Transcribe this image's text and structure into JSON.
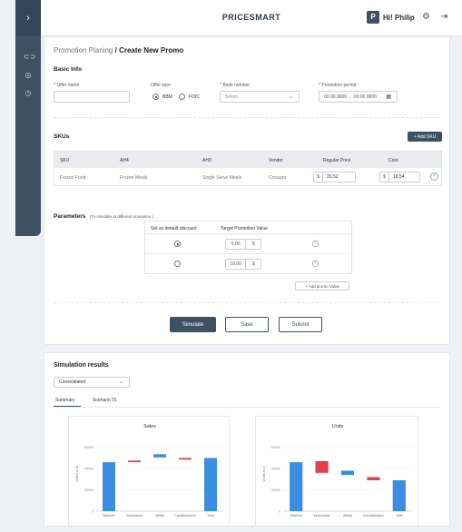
{
  "app": {
    "brand": "PRICESMART",
    "avatar_initial": "P",
    "greeting": "Hi! Philip"
  },
  "sidebar": {
    "toggle": "›",
    "icons": [
      "promo-icon",
      "tag-icon",
      "clock-icon"
    ]
  },
  "breadcrumb": {
    "parent": "Promotion Planing",
    "separator": "/",
    "current": "Create New Promo"
  },
  "basic_info": {
    "title": "Basic Info",
    "offer_name_label": "* Offer name",
    "offer_name_value": "",
    "offer_type_label": "Offer type",
    "offer_type_options": [
      "BBM",
      "FOIC"
    ],
    "offer_type_selected": "BBM",
    "book_number_label": "* Book number",
    "book_number_placeholder": "Select",
    "promo_period_label": "* Promotion period :",
    "promo_period_value": "00.00.0000  →  00.00.0000"
  },
  "skus": {
    "title": "SKUs",
    "add_label": "+  Add SKU",
    "headers": [
      "SKU",
      "AH4",
      "AH3",
      "Vendor",
      "Regular Price",
      "Cost"
    ],
    "rows": [
      {
        "sku": "Frozen Food",
        "ah4": "Frozen Meals",
        "ah3": "Single Serve Meals",
        "vendor": "Conagra",
        "regular_price_currency": "$",
        "regular_price": "20.52",
        "cost_currency": "$",
        "cost": "18.54"
      }
    ]
  },
  "parameters": {
    "title": "Parameters",
    "subtitle": "(To simulate at different scenarios )",
    "headers": [
      "Set as default discount",
      "Target Promotion Value"
    ],
    "rows": [
      {
        "default": true,
        "value": "5.00",
        "unit": "$"
      },
      {
        "default": false,
        "value": "10.00",
        "unit": "$"
      }
    ],
    "add_label": "+ Add promo Value"
  },
  "actions": {
    "simulate": "Simulate",
    "save": "Save",
    "submit": "Submit"
  },
  "results": {
    "title": "Simulation results",
    "view_selected": "Consolidated",
    "tabs": [
      "Summary",
      "Scenario 01"
    ],
    "active_tab": "Summary"
  },
  "colors": {
    "primary": "#3d5163",
    "blue": "#3a8de0",
    "red": "#e0414b"
  },
  "chart_data": [
    {
      "type": "bar",
      "subtype": "waterfall",
      "title": "Sales",
      "ylabel": "Sales in $",
      "categories": [
        "Baseline",
        "Incremental",
        "Affinity",
        "Cannibalization",
        "Total"
      ],
      "yticks": [
        "0",
        "20000",
        "40000",
        "60000"
      ],
      "ylim": [
        0,
        70000
      ],
      "bars": [
        {
          "start": 0,
          "end": 46000,
          "color": "blue"
        },
        {
          "start": 46000,
          "end": 47500,
          "color": "red"
        },
        {
          "start": 50500,
          "end": 53500,
          "color": "blue"
        },
        {
          "start": 48500,
          "end": 50000,
          "color": "red"
        },
        {
          "start": 0,
          "end": 50000,
          "color": "blue"
        }
      ]
    },
    {
      "type": "bar",
      "subtype": "waterfall",
      "title": "Units",
      "ylabel": "Units in #",
      "categories": [
        "Baseline",
        "Incremental",
        "Affinity",
        "Cannibalization",
        "Total"
      ],
      "yticks": [
        "0",
        "20000",
        "40000",
        "60000"
      ],
      "ylim": [
        0,
        70000
      ],
      "bars": [
        {
          "start": 0,
          "end": 46000,
          "color": "blue"
        },
        {
          "start": 36000,
          "end": 47000,
          "color": "red"
        },
        {
          "start": 34000,
          "end": 38000,
          "color": "blue"
        },
        {
          "start": 29000,
          "end": 32000,
          "color": "red"
        },
        {
          "start": 0,
          "end": 29000,
          "color": "blue"
        }
      ]
    }
  ]
}
